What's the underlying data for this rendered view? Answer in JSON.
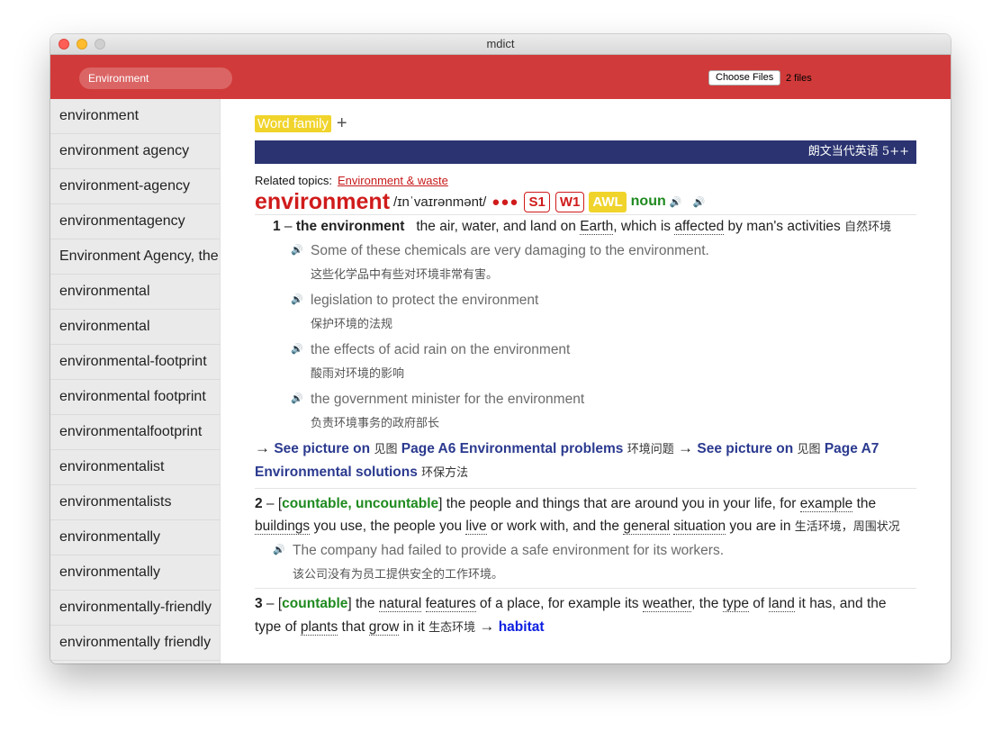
{
  "window": {
    "title": "mdict"
  },
  "toolbar": {
    "search_value": "Environment",
    "file_button": "Choose Files",
    "file_count": "2 files"
  },
  "sidebar": {
    "items": [
      "environment",
      "environment agency",
      "environment-agency",
      "environmentagency",
      "Environment Agency, the",
      "environmental",
      "environmental",
      "environmental-footprint",
      "environmental footprint",
      "environmentalfootprint",
      "environmentalist",
      "environmentalists",
      "environmentally",
      "environmentally",
      "environmentally-friendly",
      "environmentally friendly"
    ]
  },
  "entry": {
    "word_family": "Word family",
    "plus": "+",
    "dictionary_name": "朗文当代英语 5++",
    "related_label": "Related topics:",
    "related_link": "Environment & waste",
    "headword": "environment",
    "pronunciation": "/ɪnˈvaɪrənmənt/",
    "dots": "●●●",
    "freq_s": "S1",
    "freq_w": "W1",
    "awl": "AWL",
    "pos": "noun",
    "sense1": {
      "num": "1",
      "signpost": "the environment",
      "def_pre": "the air, water, and land on",
      "def_w1": "Earth",
      "def_mid": ", which is",
      "def_w2": "affected",
      "def_post": "by man's activities",
      "zh": "自然环境",
      "examples": [
        {
          "en": "Some of these chemicals are very damaging to the environment.",
          "zh": "这些化学品中有些对环境非常有害。"
        },
        {
          "en": "legislation to protect the environment",
          "zh": "保护环境的法规"
        },
        {
          "en": "the effects of acid rain on the environment",
          "zh": "酸雨对环境的影响"
        },
        {
          "en": "the government minister for the environment",
          "zh": "负责环境事务的政府部长"
        }
      ],
      "xref1_a": "See picture on",
      "xref1_zh1": "见图",
      "xref1_b": "Page A6 Environmental problems",
      "xref1_zh2": "环境问题",
      "xref2_a": "See picture on",
      "xref2_zh1": "见图",
      "xref2_b": "Page A7 Environmental solutions",
      "xref2_zh2": "环保方法"
    },
    "sense2": {
      "num": "2",
      "gram": "countable, uncountable",
      "t1": "the people and things that are around you in your life, for",
      "w1": "example",
      "t2": "the",
      "w2": "buildings",
      "t3": "you use, the people you",
      "w3": "live",
      "t4": "or work with, and the",
      "w4": "general",
      "w5": "situation",
      "t5": "you are in",
      "zh": "生活环境，周围状况",
      "ex_en": "The company had failed to provide a safe environment for its workers.",
      "ex_zh": "该公司没有为员工提供安全的工作环境。"
    },
    "sense3": {
      "num": "3",
      "gram": "countable",
      "t1": "the",
      "w1": "natural",
      "w2": "features",
      "t2": "of a place, for example its",
      "w3": "weather",
      "t3": ", the",
      "w4": "type",
      "t4": "of",
      "w5": "land",
      "t5": "it has, and the type of",
      "w6": "plants",
      "t6": "that",
      "w7": "grow",
      "t7": "in it",
      "zh": "生态环境",
      "see": "habitat"
    }
  }
}
